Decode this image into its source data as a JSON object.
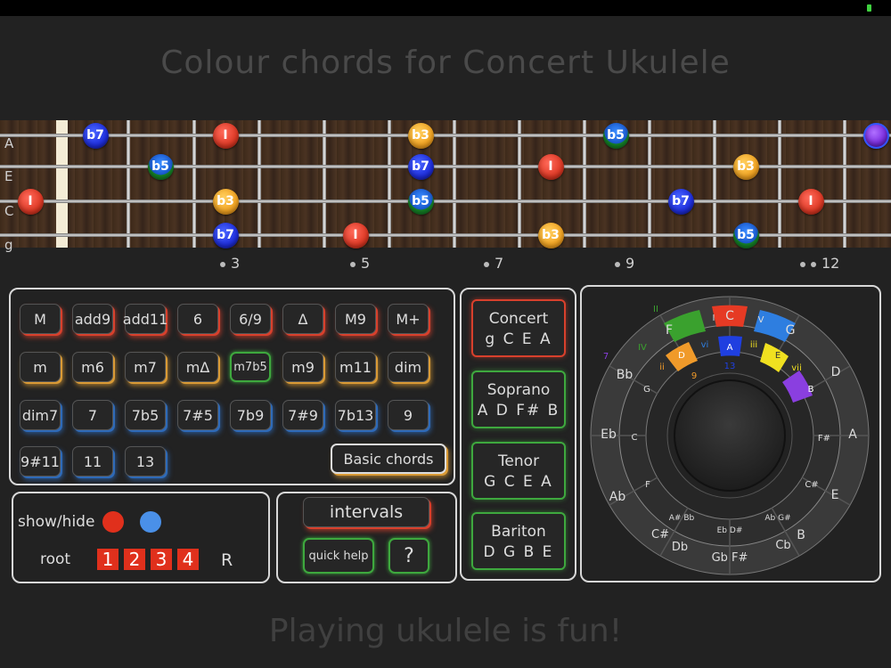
{
  "title": "Colour chords for Concert Ukulele",
  "footer": "Playing ukulele is fun!",
  "strings": [
    "A",
    "E",
    "C",
    "g"
  ],
  "fret_markers": [
    "3",
    "5",
    "7",
    "9",
    "12"
  ],
  "fret_notes": {
    "n1": "b7",
    "n2": "I",
    "n3": "b3",
    "n4": "b5",
    "n5": "b5",
    "n6": "b7",
    "n7": "I",
    "n8": "b3",
    "n9": "I",
    "n10": "b3",
    "n11": "b5",
    "n12": "b7",
    "n13": "I",
    "n14": "b7",
    "n15": "I",
    "n16": "b3",
    "n17": "b5"
  },
  "chords": {
    "row1": [
      "M",
      "add9",
      "add11",
      "6",
      "6/9",
      "Δ",
      "M9",
      "M+"
    ],
    "row2": [
      "m",
      "m6",
      "m7",
      "mΔ",
      "m7b5",
      "m9",
      "m11",
      "dim"
    ],
    "row3": [
      "dim7",
      "7",
      "7b5",
      "7#5",
      "7b9",
      "7#9",
      "7b13",
      "9"
    ],
    "row4": [
      "9#11",
      "11",
      "13"
    ],
    "basic": "Basic chords"
  },
  "tunings": [
    {
      "name": "Concert",
      "notes": "g C E A"
    },
    {
      "name": "Soprano",
      "notes": "A D F# B"
    },
    {
      "name": "Tenor",
      "notes": "G C E A"
    },
    {
      "name": "Bariton",
      "notes": "D G B E"
    }
  ],
  "controls": {
    "show_hide": "show/hide",
    "root": "root",
    "root_boxes": [
      "1",
      "2",
      "3",
      "4"
    ],
    "root_r": "R",
    "intervals": "intervals",
    "quick_help": "quick help",
    "help": "?"
  },
  "circle": {
    "outer_major": [
      "C",
      "G",
      "D",
      "A",
      "E",
      "B",
      "F#",
      "C#",
      "Ab",
      "Eb",
      "Bb",
      "F"
    ],
    "outer_lower": [
      "F#",
      "C#",
      "Cb",
      "Gb F#",
      "Db",
      "C#"
    ],
    "inner_minor": [
      "A",
      "E",
      "B",
      "F#",
      "C#",
      "G#",
      "Eb D#",
      "A# Bb",
      "F",
      "C",
      "G",
      "D"
    ],
    "inner_extra": [
      "Ab G#",
      "Eb D#",
      "A# Bb"
    ],
    "roman_outer": [
      "I",
      "V",
      "ii",
      "vi",
      "iii",
      "vii",
      "IV",
      "ii",
      "7",
      "II",
      "V",
      "vi",
      "13",
      "9"
    ],
    "colors": {
      "F": "#3aa12e",
      "C": "#e63a24",
      "G": "#2e7ee0",
      "D": "#f09a2a",
      "A": "#1f3fe0",
      "E": "#f0e020",
      "B": "#8a3fe0"
    }
  }
}
